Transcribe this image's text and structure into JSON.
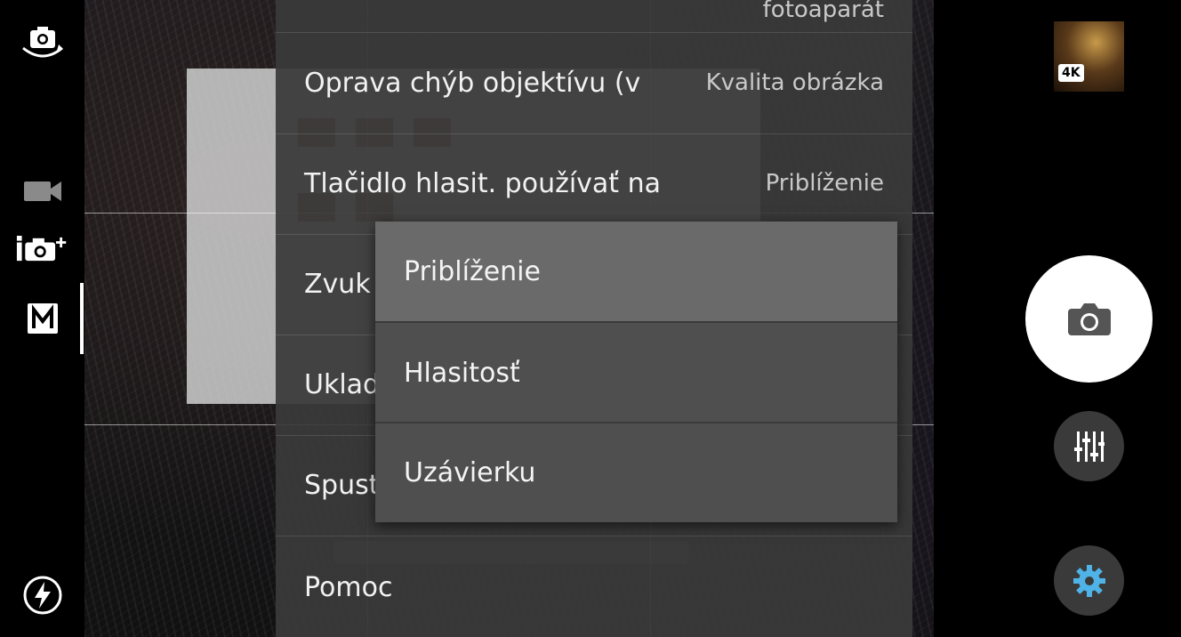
{
  "settings": {
    "rows": [
      {
        "title": "",
        "value": "fotoaparát"
      },
      {
        "title": "Oprava chýb objektívu (v",
        "value": "Kvalita obrázka"
      },
      {
        "title": "Tlačidlo hlasit. používať na",
        "value": "Priblíženie"
      },
      {
        "title": "Zvuk",
        "value": ""
      },
      {
        "title": "Uklad",
        "value": ""
      },
      {
        "title": "Spust",
        "value": ""
      },
      {
        "title": "Pomoc",
        "value": ""
      }
    ]
  },
  "dropdown": {
    "options": [
      "Priblíženie",
      "Hlasitosť",
      "Uzávierku"
    ],
    "selected": "Priblíženie"
  },
  "left_rail": {
    "icons": [
      "switch-camera-icon",
      "video-icon",
      "intelligent-auto-icon",
      "manual-mode-icon",
      "flash-auto-icon"
    ],
    "manual_label": "M",
    "iauto_label": "i"
  },
  "right_rail": {
    "thumbnail_badge": "4K",
    "icons": [
      "camera-icon",
      "sliders-icon",
      "gear-icon"
    ],
    "gear_color": "#4fb3e8"
  }
}
